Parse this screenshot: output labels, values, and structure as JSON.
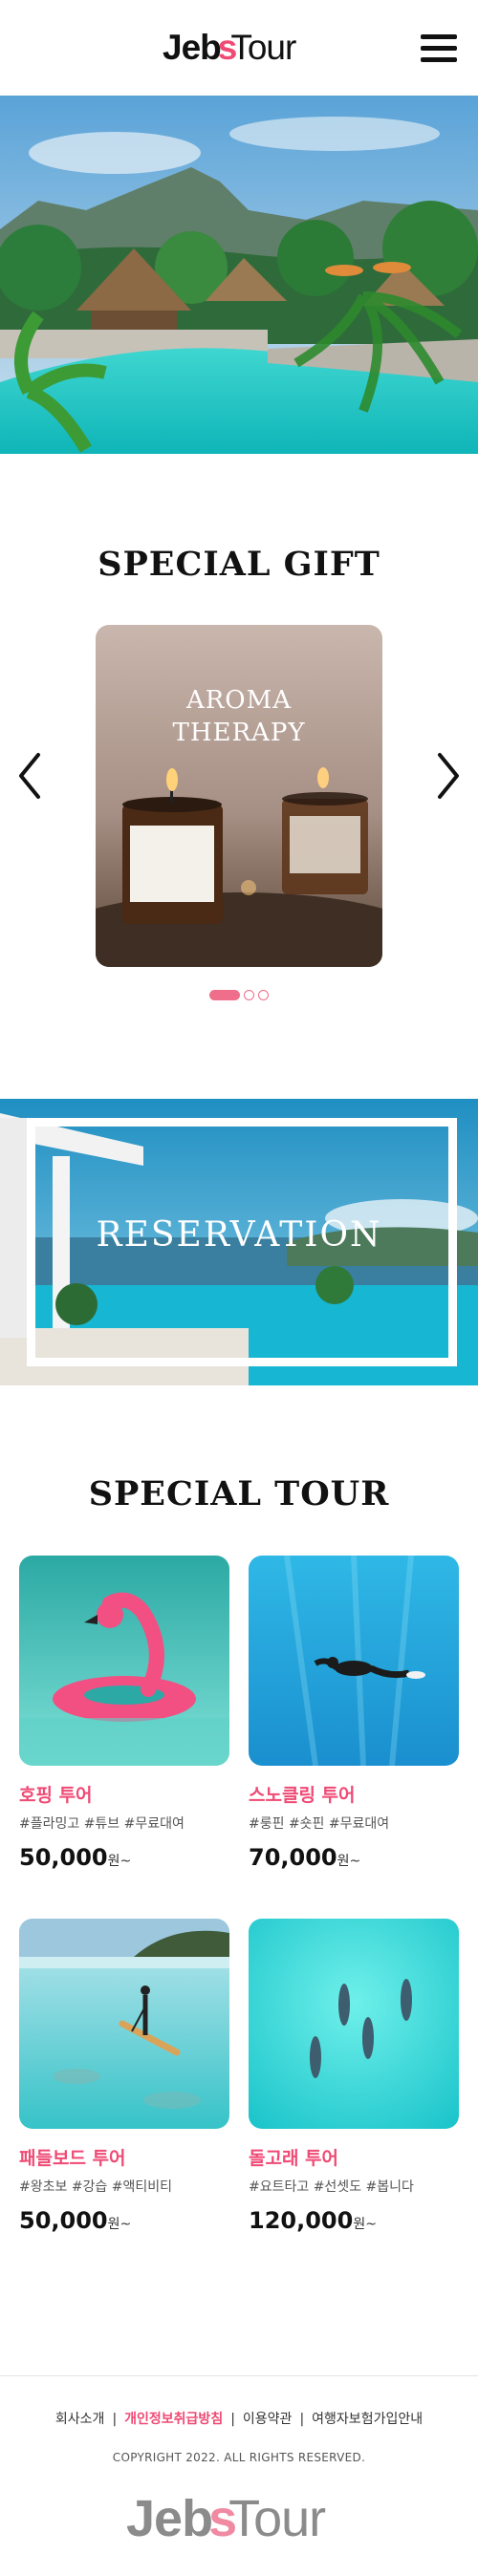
{
  "header": {
    "logo": {
      "part1": "Jeb",
      "part2": "s",
      "part3": "Tour"
    },
    "menu_icon": "hamburger-menu-icon"
  },
  "hero": {
    "image": "tropical-resort-pool-photo"
  },
  "special_gift": {
    "title": "SPECIAL GIFT",
    "card": {
      "line1": "AROMA",
      "line2": "THERAPY"
    },
    "prev_icon": "chevron-left-icon",
    "next_icon": "chevron-right-icon",
    "pagination": {
      "total": 3,
      "active": 1
    }
  },
  "reservation": {
    "label": "RESERVATION"
  },
  "special_tour": {
    "title": "SPECIAL TOUR",
    "items": [
      {
        "name": "호핑 투어",
        "tags": "#플라밍고 #튜브 #무료대여",
        "price": "50,000",
        "unit": "원~"
      },
      {
        "name": "스노클링 투어",
        "tags": "#룽핀 #숏핀 #무료대여",
        "price": "70,000",
        "unit": "원~"
      },
      {
        "name": "패들보드 투어",
        "tags": "#왕초보 #강습 #액티비티",
        "price": "50,000",
        "unit": "원~"
      },
      {
        "name": "돌고래 투어",
        "tags": "#요트타고 #선셋도 #봅니다",
        "price": "120,000",
        "unit": "원~"
      }
    ]
  },
  "footer": {
    "links": [
      "회사소개",
      "개인정보취급방침",
      "이용약관",
      "여행자보험가입안내"
    ],
    "separator": "|",
    "copyright": "COPYRIGHT 2022. ALL RIGHTS RESERVED.",
    "logo": {
      "part1": "Jeb",
      "part2": "s",
      "part3": "Tour"
    }
  },
  "colors": {
    "accent": "#ef4a74",
    "text": "#111111",
    "footer_logo": "#8b8b8b"
  }
}
